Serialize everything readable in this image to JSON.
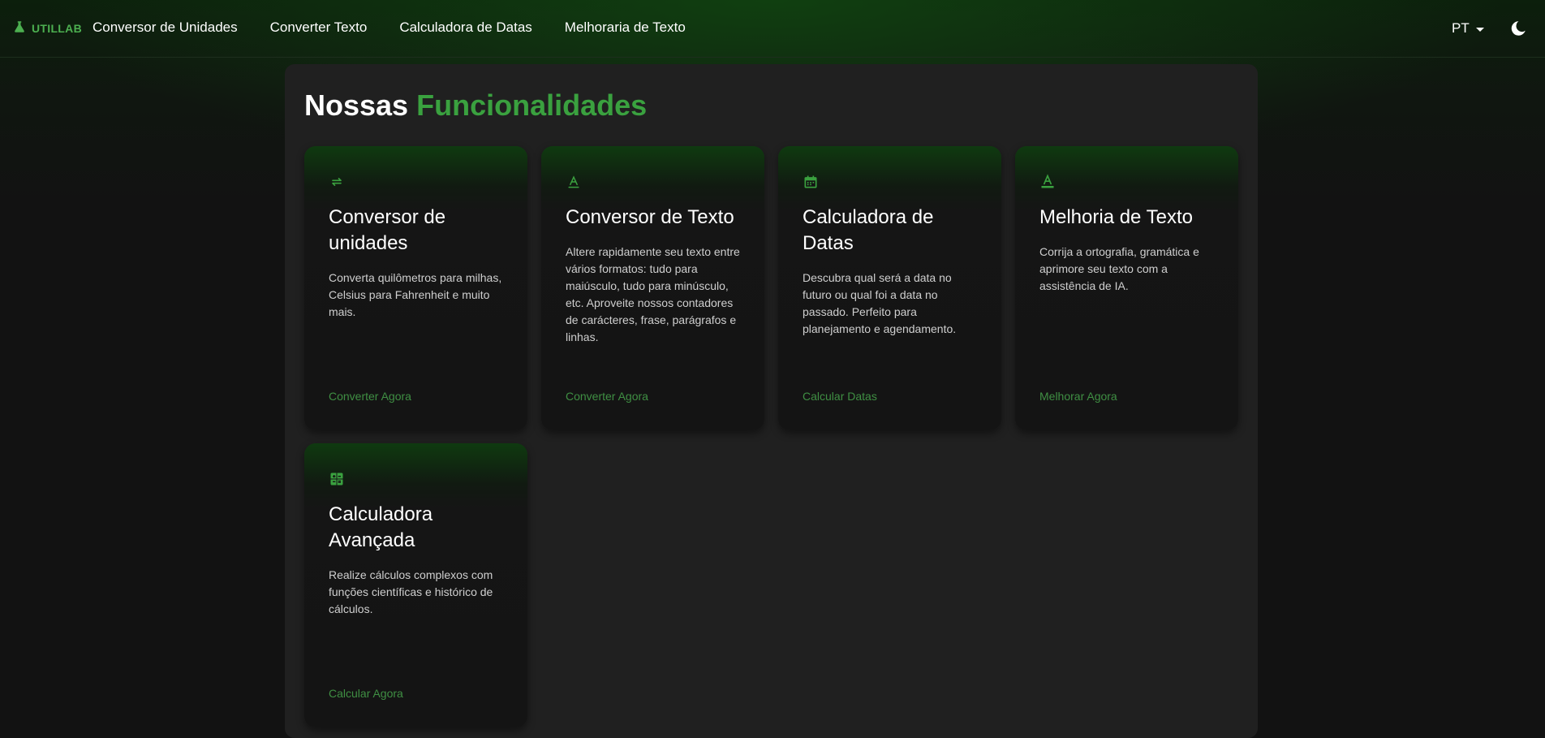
{
  "brand": {
    "name": "UTILLAB",
    "icon": "flask-icon"
  },
  "nav": {
    "links": [
      "Conversor de Unidades",
      "Converter Texto",
      "Calculadora de Datas",
      "Melhoraria de Texto"
    ],
    "language": "PT",
    "theme_icon": "moon-icon"
  },
  "heading": {
    "part1": "Nossas",
    "part2": "Funcionalidades"
  },
  "colors": {
    "accent": "#3aa13f",
    "link": "#3f8f43",
    "panel": "#202020",
    "background": "#121212"
  },
  "cards": [
    {
      "icon": "swap-arrows-icon",
      "title": "Conversor de unidades",
      "description": "Converta quilômetros para milhas, Celsius para Fahrenheit e muito mais.",
      "link": "Converter Agora"
    },
    {
      "icon": "text-format-icon",
      "title": "Conversor de Texto",
      "description": "Altere rapidamente seu texto entre vários formatos: tudo para maiúsculo, tudo para minúsculo, etc. Aproveite nossos contadores de carácteres, frase, parágrafos e linhas.",
      "link": "Converter Agora"
    },
    {
      "icon": "calendar-icon",
      "title": "Calculadora de Datas",
      "description": "Descubra qual será a data no futuro ou qual foi a data no passado. Perfeito para planejamento e agendamento.",
      "link": "Calcular Datas"
    },
    {
      "icon": "text-color-icon",
      "title": "Melhoria de Texto",
      "description": "Corrija a ortografia, gramática e aprimore seu texto com a assistência de IA.",
      "link": "Melhorar Agora"
    },
    {
      "icon": "calculator-icon",
      "title": "Calculadora Avançada",
      "description": "Realize cálculos complexos com funções científicas e histórico de cálculos.",
      "link": "Calcular Agora"
    }
  ]
}
